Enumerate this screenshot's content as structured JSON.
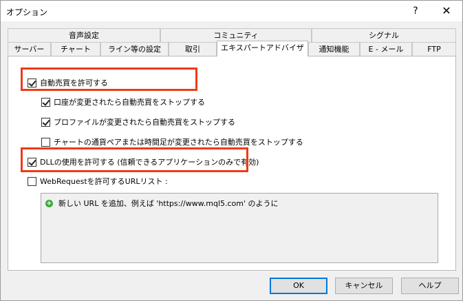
{
  "window": {
    "title": "オプション",
    "help_symbol": "?",
    "close_symbol": "✕"
  },
  "tabs": {
    "row1": [
      "音声設定",
      "コミュニティ",
      "シグナル"
    ],
    "row2": [
      "サーバー",
      "チャート",
      "ライン等の設定",
      "取引",
      "エキスパートアドバイザ",
      "通知機能",
      "E - メール",
      "FTP"
    ],
    "active": "エキスパートアドバイザ"
  },
  "options": {
    "allow_auto_trading": {
      "label": "自動売買を許可する",
      "checked": true
    },
    "stop_on_account_change": {
      "label": "口座が変更されたら自動売買をストップする",
      "checked": true
    },
    "stop_on_profile_change": {
      "label": "プロファイルが変更されたら自動売買をストップする",
      "checked": true
    },
    "stop_on_symbol_change": {
      "label": "チャートの通貨ペアまたは時間足が変更されたら自動売買をストップする",
      "checked": false
    },
    "allow_dll": {
      "label": "DLLの使用を許可する (信頼できるアプリケーションのみで有効)",
      "checked": true
    },
    "allow_webrequest": {
      "label": "WebRequestを許可するURLリスト :",
      "checked": false
    }
  },
  "url_list": {
    "add_hint": "新しい URL を追加、例えば 'https://www.mql5.com' のように"
  },
  "buttons": {
    "ok": "OK",
    "cancel": "キャンセル",
    "help": "ヘルプ"
  },
  "colors": {
    "highlight": "#ee3a19",
    "add_icon": "#3aa83a",
    "default_button_border": "#0078d7"
  }
}
